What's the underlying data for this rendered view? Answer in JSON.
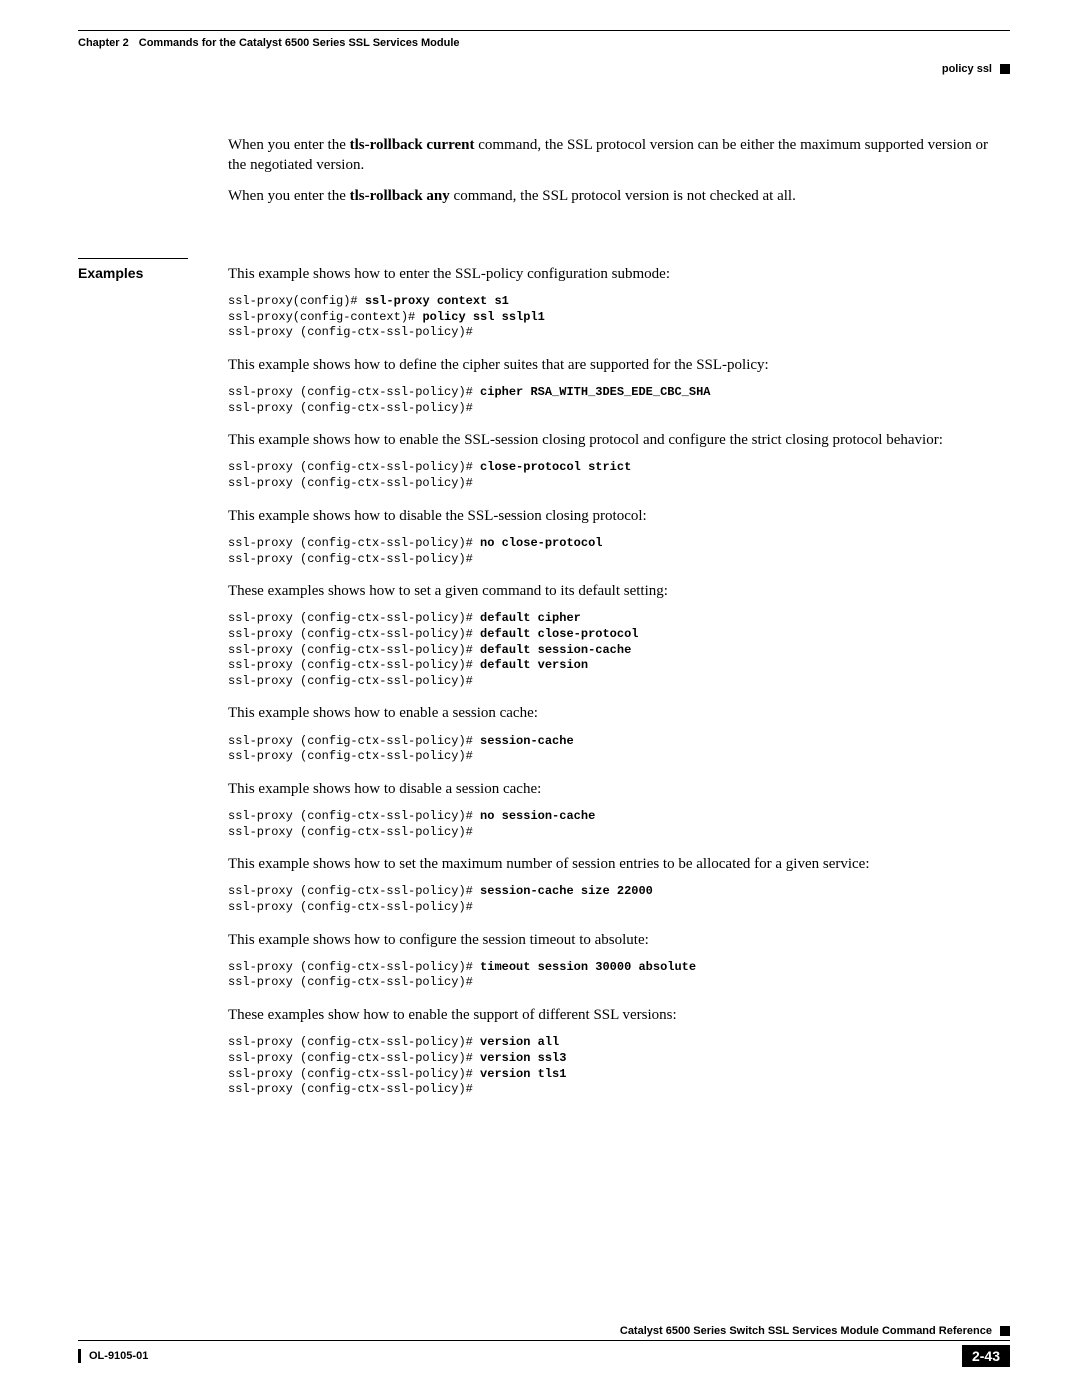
{
  "header": {
    "chapter": "Chapter 2",
    "chapter_title": "Commands for the Catalyst 6500 Series SSL Services Module",
    "topic": "policy ssl"
  },
  "intro": {
    "p1a": "When you enter the ",
    "p1b": "tls-rollback current",
    "p1c": " command, the SSL protocol version can be either the maximum supported version or the negotiated version.",
    "p2a": "When you enter the ",
    "p2b": "tls-rollback any",
    "p2c": " command, the SSL protocol version is not checked at all."
  },
  "examples": {
    "label": "Examples",
    "ex1": {
      "desc": "This example shows how to enter the SSL-policy configuration submode:",
      "l1a": "ssl-proxy(config)# ",
      "l1b": "ssl-proxy context s1",
      "l2a": "ssl-proxy(config-context)# ",
      "l2b": "policy ssl sslpl1",
      "l3": "ssl-proxy (config-ctx-ssl-policy)# "
    },
    "ex2": {
      "desc": "This example shows how to define the cipher suites that are supported for the SSL-policy:",
      "l1a": "ssl-proxy (config-ctx-ssl-policy)# ",
      "l1b": "cipher RSA_WITH_3DES_EDE_CBC_SHA",
      "l2": "ssl-proxy (config-ctx-ssl-policy)# "
    },
    "ex3": {
      "desc": "This example shows how to enable the SSL-session closing protocol and configure the strict closing protocol behavior:",
      "l1a": "ssl-proxy (config-ctx-ssl-policy)# ",
      "l1b": "close-protocol strict",
      "l2": "ssl-proxy (config-ctx-ssl-policy)# "
    },
    "ex4": {
      "desc": "This example shows how to disable the SSL-session closing protocol:",
      "l1a": "ssl-proxy (config-ctx-ssl-policy)# ",
      "l1b": "no close-protocol",
      "l2": "ssl-proxy (config-ctx-ssl-policy)# "
    },
    "ex5": {
      "desc": "These examples shows how to set a given command to its default setting:",
      "l1a": "ssl-proxy (config-ctx-ssl-policy)# ",
      "l1b": "default cipher",
      "l2a": "ssl-proxy (config-ctx-ssl-policy)# ",
      "l2b": "default close-protocol",
      "l3a": "ssl-proxy (config-ctx-ssl-policy)# ",
      "l3b": "default session-cache",
      "l4a": "ssl-proxy (config-ctx-ssl-policy)# ",
      "l4b": "default version",
      "l5": "ssl-proxy (config-ctx-ssl-policy)# "
    },
    "ex6": {
      "desc": "This example shows how to enable a session cache:",
      "l1a": "ssl-proxy (config-ctx-ssl-policy)# ",
      "l1b": "session-cache",
      "l2": "ssl-proxy (config-ctx-ssl-policy)# "
    },
    "ex7": {
      "desc": "This example shows how to disable a session cache:",
      "l1a": "ssl-proxy (config-ctx-ssl-policy)# ",
      "l1b": "no session-cache",
      "l2": "ssl-proxy (config-ctx-ssl-policy)# "
    },
    "ex8": {
      "desc": "This example shows how to set the maximum number of session entries to be allocated for a given service:",
      "l1a": "ssl-proxy (config-ctx-ssl-policy)# ",
      "l1b": "session-cache size 22000",
      "l2": "ssl-proxy (config-ctx-ssl-policy)# "
    },
    "ex9": {
      "desc": "This example shows how to configure the session timeout to absolute:",
      "l1a": "ssl-proxy (config-ctx-ssl-policy)# ",
      "l1b": "timeout session 30000 absolute",
      "l2": "ssl-proxy (config-ctx-ssl-policy)# "
    },
    "ex10": {
      "desc": "These examples show how to enable the support of different SSL versions:",
      "l1a": "ssl-proxy (config-ctx-ssl-policy)# ",
      "l1b": "version all",
      "l2a": "ssl-proxy (config-ctx-ssl-policy)# ",
      "l2b": "version ssl3",
      "l3a": "ssl-proxy (config-ctx-ssl-policy)# ",
      "l3b": "version tls1",
      "l4": "ssl-proxy (config-ctx-ssl-policy)# "
    }
  },
  "footer": {
    "doc_title": "Catalyst 6500 Series Switch SSL Services Module Command Reference",
    "doc_id": "OL-9105-01",
    "page": "2-43"
  }
}
